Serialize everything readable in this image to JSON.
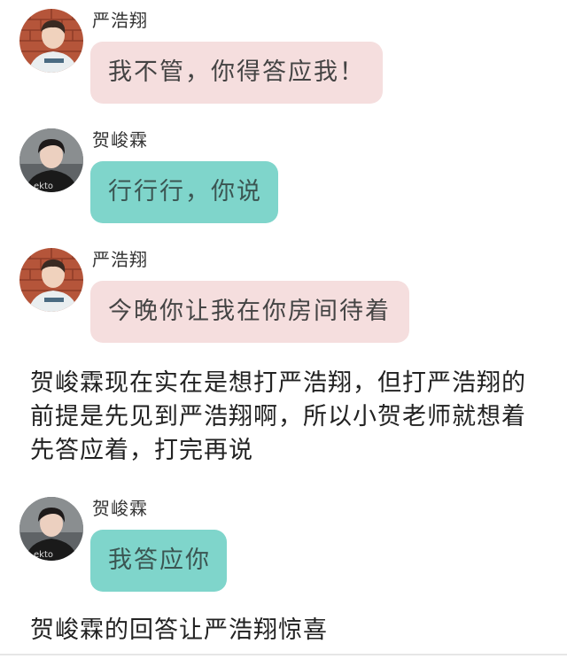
{
  "messages": [
    {
      "sender": "严浩翔",
      "text": "我不管，你得答应我！",
      "style": "pink",
      "avatar": "brick-wall-avatar"
    },
    {
      "sender": "贺峻霖",
      "text": "行行行，你说",
      "style": "teal",
      "avatar": "dark-avatar"
    },
    {
      "sender": "严浩翔",
      "text": "今晚你让我在你房间待着",
      "style": "pink",
      "avatar": "brick-wall-avatar"
    },
    {
      "sender": "贺峻霖",
      "text": "我答应你",
      "style": "teal",
      "avatar": "dark-avatar"
    }
  ],
  "narration": [
    "贺峻霖现在实在是想打严浩翔，但打严浩翔的前提是先见到严浩翔啊，所以小贺老师就想着先答应着，打完再说",
    "贺峻霖的回答让严浩翔惊喜"
  ],
  "colors": {
    "pink_bubble": "#f5dede",
    "teal_bubble": "#7fd5cb"
  }
}
